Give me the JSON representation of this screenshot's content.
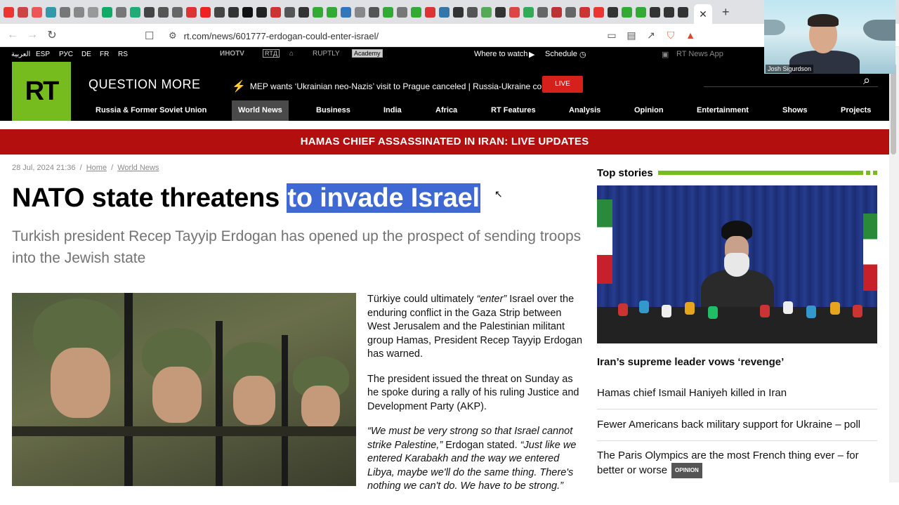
{
  "browser": {
    "url": "rt.com/news/601777-erdogan-could-enter-israel/",
    "active_tab_close": "✕",
    "new_tab": "+"
  },
  "webcam": {
    "name": "Josh Sigurdson"
  },
  "rt_topbar": {
    "languages": [
      "العربية",
      "ESP",
      "РУС",
      "DE",
      "FR",
      "RS"
    ],
    "partners": [
      "ИНОТV",
      "RTД",
      "RUPTLY",
      "Academy"
    ],
    "where_to_watch": "Where to watch",
    "schedule": "Schedule",
    "news_app": "RT News App"
  },
  "header": {
    "logo": "RT",
    "tagline": "QUESTION MORE",
    "ticker": "MEP wants ‘Ukrainian neo-Nazis’ visit to Prague canceled | Russia-Ukraine conflict",
    "live": "LIVE"
  },
  "nav": {
    "items": [
      "Russia & Former Soviet Union",
      "World News",
      "Business",
      "India",
      "Africa",
      "RT Features",
      "Analysis",
      "Opinion",
      "Entertainment",
      "Shows",
      "Projects"
    ],
    "active": "World News"
  },
  "breaking": "HAMAS CHIEF ASSASSINATED IN IRAN: LIVE UPDATES",
  "article": {
    "date": "28 Jul, 2024 21:36",
    "sep": "/",
    "crumb_home": "Home",
    "crumb_section": "World News",
    "headline_start": "NATO state threatens ",
    "headline_highlight": "to invade Israel",
    "standfirst": "Turkish president Recep Tayyip Erdogan has opened up the prospect of sending troops into the Jewish state",
    "p1_a": "Türkiye could ultimately ",
    "p1_q": "“enter”",
    "p1_b": " Israel over the enduring conflict in the Gaza Strip between West Jerusalem and the Palestinian militant group Hamas, President Recep Tayyip Erdogan has warned.",
    "p2": "The president issued the threat on Sunday as he spoke during a rally of his ruling Justice and Development Party (AKP).",
    "p3_q1": "“We must be very strong so that Israel cannot strike Palestine,”",
    "p3_mid": " Erdogan stated. ",
    "p3_q2": "“Just like we entered Karabakh and the way we entered Libya, maybe we'll do the same thing. There's nothing we can't do. We have to be strong.”"
  },
  "sidebar": {
    "title": "Top stories",
    "stories": [
      {
        "title": "Iran’s supreme leader vows ‘revenge’",
        "badge": ""
      },
      {
        "title": "Hamas chief Ismail Haniyeh killed in Iran",
        "badge": ""
      },
      {
        "title": "Fewer Americans back military support for Ukraine – poll",
        "badge": ""
      },
      {
        "title": "The Paris Olympics are the most French thing ever – for better or worse",
        "badge": "OPINION"
      }
    ]
  },
  "colors": {
    "rt_green": "#77bc1f",
    "breaking_red": "#b40f0f",
    "live_red": "#d6201b",
    "highlight_blue": "#3e69d4"
  }
}
